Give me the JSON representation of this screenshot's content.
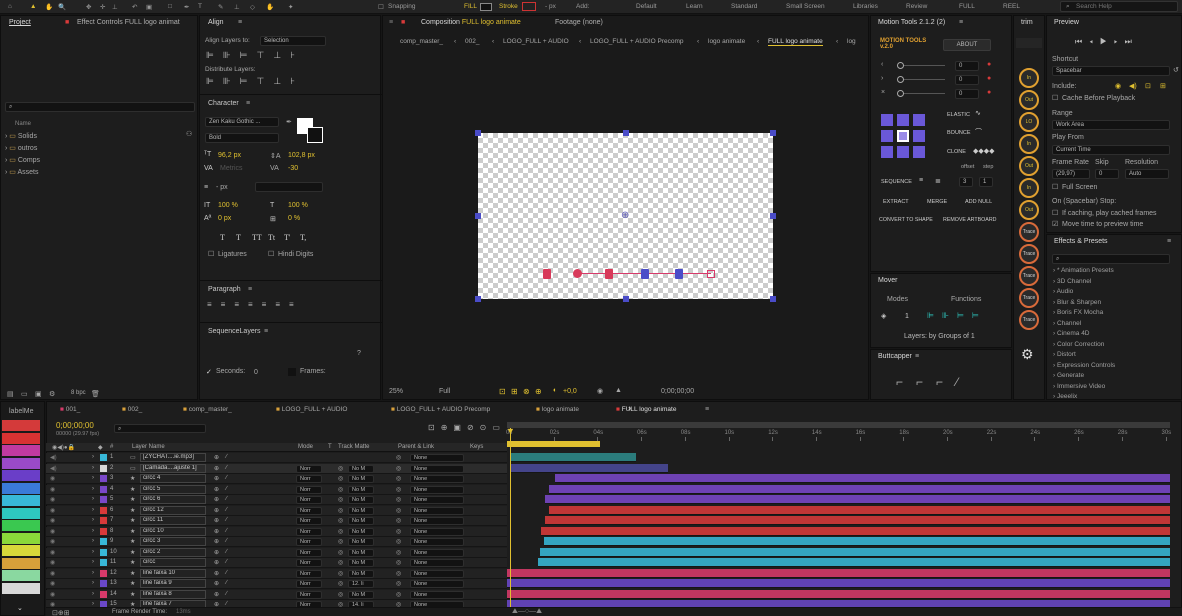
{
  "toolbar": {
    "snapping": "Snapping",
    "fill": "FILL",
    "stroke": "Stroke",
    "px": "- px",
    "add": "Add:",
    "workspaces": [
      "Default",
      "Learn",
      "Standard",
      "Small Screen",
      "Libraries",
      "Review",
      "FULL",
      "REEL"
    ],
    "search_placeholder": "Search Help"
  },
  "project": {
    "tab": "Project",
    "effect_controls": "Effect Controls FULL logo animat",
    "search_placeholder": "",
    "col_name": "Name",
    "items": [
      "Solids",
      "outros",
      "Comps",
      "Assets"
    ],
    "bpc": "8 bpc"
  },
  "align": {
    "title": "Align",
    "align_to_label": "Align Layers to:",
    "align_to_value": "Selection",
    "distribute": "Distribute Layers:"
  },
  "character": {
    "title": "Character",
    "font": "Zen Kaku Gothic ...",
    "style": "Bold",
    "size": "96,2 px",
    "leading": "102,8 px",
    "kerning": "Metrics",
    "tracking": "-30",
    "stroke_px": "- px",
    "vscale": "100 %",
    "hscale": "100 %",
    "baseline": "0 px",
    "tsume": "0 %",
    "ligatures": "Ligatures",
    "hindi": "Hindi Digits",
    "styles": [
      "T",
      "T",
      "TT",
      "Tt",
      "T'",
      "T,"
    ]
  },
  "paragraph": {
    "title": "Paragraph"
  },
  "sequence_layers": {
    "title": "SequenceLayers",
    "seconds_label": "Seconds:",
    "seconds_value": "0",
    "frames_label": "Frames:",
    "help": "?"
  },
  "composition": {
    "tab": "Composition",
    "tab_name": "FULL logo animate",
    "footage": "Footage (none)",
    "crumbs": [
      "comp_master_",
      "002_",
      "LOGO_FULL + AUDIO",
      "LOGO_FULL + AUDIO Precomp",
      "logo animate",
      "FULL logo animate",
      "log"
    ],
    "zoom": "25%",
    "quality": "Full",
    "exposure": "+0,0",
    "timecode": "0;00;00;00"
  },
  "motion_tools": {
    "title": "Motion Tools 2.1.2 (2)",
    "logo": "MOTION TOOLS v.2.0",
    "about": "ABOUT",
    "values": [
      "0",
      "0",
      "0"
    ],
    "elastic": "ELASTIC",
    "bounce": "BOUNCE",
    "clone": "CLONE",
    "offset": "offset",
    "step": "step",
    "sequence": "SEQUENCE",
    "seq_vals": [
      "3",
      "1"
    ],
    "extract": "EXTRACT",
    "merge": "MERGE",
    "add_null": "ADD NULL",
    "convert": "CONVERT TO SHAPE",
    "remove": "REMOVE ARTBOARD"
  },
  "mover": {
    "title": "Mover",
    "modes": "Modes",
    "functions": "Functions",
    "count": "1",
    "layers_by": "Layers: by Groups of 1"
  },
  "buttcapper": {
    "title": "Buttcapper"
  },
  "trim": {
    "title": "trim",
    "buttons": [
      "In",
      "Out",
      "LO",
      "In",
      "Out",
      "In",
      "Out",
      "Trace In",
      "Trace Out",
      "Trace LO",
      "Trace In",
      "Trace Out"
    ]
  },
  "preview": {
    "title": "Preview",
    "shortcut_label": "Shortcut",
    "shortcut": "Spacebar",
    "include": "Include:",
    "cache": "Cache Before Playback",
    "range_label": "Range",
    "range": "Work Area",
    "play_from_label": "Play From",
    "play_from": "Current Time",
    "frame_rate_label": "Frame Rate",
    "skip_label": "Skip",
    "resolution_label": "Resolution",
    "frame_rate": "(29,97)",
    "skip": "0",
    "resolution": "Auto",
    "full_screen": "Full Screen",
    "on_stop": "On (Spacebar) Stop:",
    "if_caching": "If caching, play cached frames",
    "move_time": "Move time to preview time"
  },
  "effects": {
    "title": "Effects & Presets",
    "search_placeholder": "",
    "items": [
      "* Animation Presets",
      "3D Channel",
      "Audio",
      "Blur & Sharpen",
      "Boris FX Mocha",
      "Channel",
      "Cinema 4D",
      "Color Correction",
      "Distort",
      "Expression Controls",
      "Generate",
      "Immersive Video",
      "Jeeelix"
    ]
  },
  "labels": {
    "title": "labelMe",
    "colors": [
      "#d43a3a",
      "#d83232",
      "#c03aa0",
      "#9a4ac8",
      "#6a3ec8",
      "#3a7ad8",
      "#38b8d8",
      "#2ec8c0",
      "#3ac850",
      "#8ad83a",
      "#d8d83a",
      "#d8a03a",
      "#8ad8a0",
      "#d8d8d8"
    ]
  },
  "timeline": {
    "tabs": [
      "001_",
      "002_",
      "comp_master_",
      "LOGO_FULL + AUDIO",
      "LOGO_FULL + AUDIO Precomp",
      "logo animate",
      "FULL logo animate"
    ],
    "tab_colors": [
      "#d83a6a",
      "#d8a03a",
      "#d8a03a",
      "#d8a03a",
      "#d8a03a",
      "#d8a03a",
      "#d83a3a"
    ],
    "timecode": "0;00;00;00",
    "fps": "00000 (29.97 fps)",
    "cols": {
      "layer_name": "Layer Name",
      "mode": "Mode",
      "t": "T",
      "track_matte": "Track Matte",
      "parent": "Parent & Link",
      "keys": "Keys"
    },
    "ticks": [
      "0s",
      "02s",
      "04s",
      "06s",
      "08s",
      "10s",
      "12s",
      "14s",
      "16s",
      "18s",
      "20s",
      "22s",
      "24s",
      "26s",
      "28s",
      "30s"
    ],
    "frame_render": "Frame Render Time:",
    "frame_render_val": "13ms",
    "layers": [
      {
        "num": "1",
        "name": "[ZYCHAT....ie.mp3]",
        "color": "#38b8d8",
        "mode": "",
        "matte": "",
        "parent": "None"
      },
      {
        "num": "2",
        "name": "[Camada....ajuste 1]",
        "color": "#d8d8d8",
        "mode": "Norr",
        "matte": "No M",
        "parent": "None"
      },
      {
        "num": "3",
        "name": "circc 4",
        "color": "#7a48c8",
        "mode": "Norr",
        "matte": "No M",
        "parent": "None"
      },
      {
        "num": "4",
        "name": "circc 5",
        "color": "#7a48c8",
        "mode": "Norr",
        "matte": "No M",
        "parent": "None"
      },
      {
        "num": "5",
        "name": "circc 6",
        "color": "#7a48c8",
        "mode": "Norr",
        "matte": "No M",
        "parent": "None"
      },
      {
        "num": "6",
        "name": "circc 12",
        "color": "#d83a3a",
        "mode": "Norr",
        "matte": "No M",
        "parent": "None"
      },
      {
        "num": "7",
        "name": "circc 11",
        "color": "#d83a3a",
        "mode": "Norr",
        "matte": "No M",
        "parent": "None"
      },
      {
        "num": "8",
        "name": "circc 10",
        "color": "#d83a3a",
        "mode": "Norr",
        "matte": "No M",
        "parent": "None"
      },
      {
        "num": "9",
        "name": "circc 3",
        "color": "#38b8d8",
        "mode": "Norr",
        "matte": "No M",
        "parent": "None"
      },
      {
        "num": "10",
        "name": "circc 2",
        "color": "#38b8d8",
        "mode": "Norr",
        "matte": "No M",
        "parent": "None"
      },
      {
        "num": "11",
        "name": "circc",
        "color": "#38b8d8",
        "mode": "Norr",
        "matte": "No M",
        "parent": "None"
      },
      {
        "num": "12",
        "name": "line faixa 10",
        "color": "#d83a6a",
        "mode": "Norr",
        "matte": "No M",
        "parent": "None"
      },
      {
        "num": "13",
        "name": "line faixa 9",
        "color": "#6a48c8",
        "mode": "Norr",
        "matte": "12. li",
        "parent": "None"
      },
      {
        "num": "14",
        "name": "line faixa 8",
        "color": "#d83a6a",
        "mode": "Norr",
        "matte": "No M",
        "parent": "None"
      },
      {
        "num": "15",
        "name": "line faixa 7",
        "color": "#6a48c8",
        "mode": "Norr",
        "matte": "14. li",
        "parent": "None"
      }
    ]
  }
}
